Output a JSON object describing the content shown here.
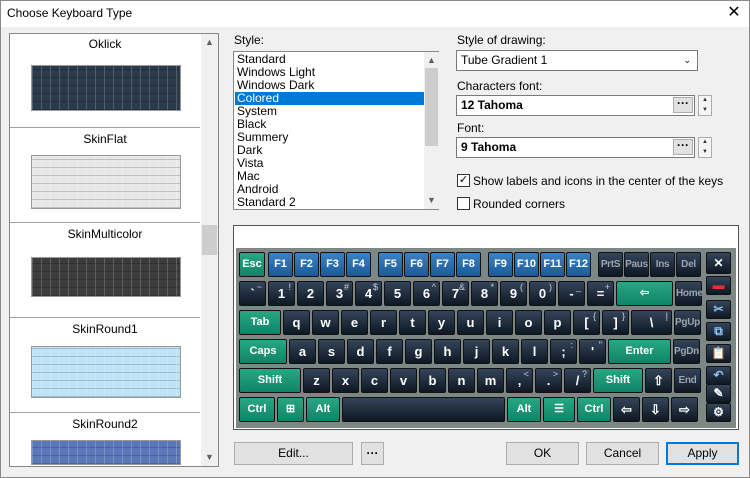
{
  "window": {
    "title": "Choose Keyboard Type",
    "close": "✕"
  },
  "skins": [
    {
      "name": "Oklick",
      "color": "#2a3a4c"
    },
    {
      "name": "SkinFlat",
      "color": "#e8e8e8"
    },
    {
      "name": "SkinMulticolor",
      "color": "#3c3c3c"
    },
    {
      "name": "SkinRound1",
      "color": "#bfe4f8"
    },
    {
      "name": "SkinRound2",
      "color": "#5a78b8"
    }
  ],
  "style": {
    "label": "Style:",
    "items": [
      "Standard",
      "Windows Light",
      "Windows Dark",
      "Colored",
      "System",
      "Black",
      "Summery",
      "Dark",
      "Vista",
      "Mac",
      "Android",
      "Standard 2"
    ],
    "selected": "Colored"
  },
  "drawing": {
    "label": "Style of drawing:",
    "value": "Tube Gradient 1"
  },
  "chars_font": {
    "label": "Characters font:",
    "value": "12 Tahoma",
    "browse": "···"
  },
  "font": {
    "label": "Font:",
    "value": "9 Tahoma",
    "browse": "···"
  },
  "options": {
    "show_labels": {
      "label": "Show labels and icons in the center of the keys",
      "checked": true
    },
    "rounded": {
      "label": "Rounded corners",
      "checked": false
    }
  },
  "keyboard": {
    "rows": [
      [
        {
          "l": "Esc",
          "c": "green"
        },
        {
          "l": "F1",
          "c": "blue"
        },
        {
          "l": "F2",
          "c": "blue"
        },
        {
          "l": "F3",
          "c": "blue"
        },
        {
          "l": "F4",
          "c": "blue"
        },
        {
          "l": "F5",
          "c": "blue"
        },
        {
          "l": "F6",
          "c": "blue"
        },
        {
          "l": "F7",
          "c": "blue"
        },
        {
          "l": "F8",
          "c": "blue"
        },
        {
          "l": "F9",
          "c": "blue"
        },
        {
          "l": "F10",
          "c": "blue"
        },
        {
          "l": "F11",
          "c": "blue"
        },
        {
          "l": "F12",
          "c": "blue"
        },
        {
          "l": "PrtS",
          "c": "gray"
        },
        {
          "l": "Paus",
          "c": "gray"
        },
        {
          "l": "Ins",
          "c": "gray"
        },
        {
          "l": "Del",
          "c": "gray"
        }
      ],
      [
        {
          "l": "`",
          "s": "~",
          "c": "dark"
        },
        {
          "l": "1",
          "s": "!",
          "c": "dark"
        },
        {
          "l": "2",
          "s": "",
          "c": "dark"
        },
        {
          "l": "3",
          "s": "#",
          "c": "dark"
        },
        {
          "l": "4",
          "s": "$",
          "c": "dark"
        },
        {
          "l": "5",
          "s": "",
          "c": "dark"
        },
        {
          "l": "6",
          "s": "^",
          "c": "dark"
        },
        {
          "l": "7",
          "s": "&",
          "c": "dark"
        },
        {
          "l": "8",
          "s": "*",
          "c": "dark"
        },
        {
          "l": "9",
          "s": "(",
          "c": "dark"
        },
        {
          "l": "0",
          "s": ")",
          "c": "dark"
        },
        {
          "l": "-",
          "s": "_",
          "c": "dark"
        },
        {
          "l": "=",
          "s": "+",
          "c": "dark"
        },
        {
          "l": "⇦",
          "c": "green"
        },
        {
          "l": "Home",
          "c": "gray"
        }
      ],
      [
        {
          "l": "Tab",
          "c": "green"
        },
        {
          "l": "q",
          "c": "dark"
        },
        {
          "l": "w",
          "c": "dark"
        },
        {
          "l": "e",
          "c": "dark"
        },
        {
          "l": "r",
          "c": "dark"
        },
        {
          "l": "t",
          "c": "dark"
        },
        {
          "l": "y",
          "c": "dark"
        },
        {
          "l": "u",
          "c": "dark"
        },
        {
          "l": "i",
          "c": "dark"
        },
        {
          "l": "o",
          "c": "dark"
        },
        {
          "l": "p",
          "c": "dark"
        },
        {
          "l": "[",
          "s": "{",
          "c": "dark"
        },
        {
          "l": "]",
          "s": "}",
          "c": "dark"
        },
        {
          "l": "\\",
          "s": "|",
          "c": "dark"
        },
        {
          "l": "PgUp",
          "c": "gray"
        }
      ],
      [
        {
          "l": "Caps",
          "c": "green"
        },
        {
          "l": "a",
          "c": "dark"
        },
        {
          "l": "s",
          "c": "dark"
        },
        {
          "l": "d",
          "c": "dark"
        },
        {
          "l": "f",
          "c": "dark"
        },
        {
          "l": "g",
          "c": "dark"
        },
        {
          "l": "h",
          "c": "dark"
        },
        {
          "l": "j",
          "c": "dark"
        },
        {
          "l": "k",
          "c": "dark"
        },
        {
          "l": "l",
          "c": "dark"
        },
        {
          "l": ";",
          "s": ":",
          "c": "dark"
        },
        {
          "l": "'",
          "s": "\"",
          "c": "dark"
        },
        {
          "l": "Enter",
          "c": "green"
        },
        {
          "l": "PgDn",
          "c": "gray"
        }
      ],
      [
        {
          "l": "Shift",
          "c": "green"
        },
        {
          "l": "z",
          "c": "dark"
        },
        {
          "l": "x",
          "c": "dark"
        },
        {
          "l": "c",
          "c": "dark"
        },
        {
          "l": "v",
          "c": "dark"
        },
        {
          "l": "b",
          "c": "dark"
        },
        {
          "l": "n",
          "c": "dark"
        },
        {
          "l": "m",
          "c": "dark"
        },
        {
          "l": ",",
          "s": "<",
          "c": "dark"
        },
        {
          "l": ".",
          "s": ">",
          "c": "dark"
        },
        {
          "l": "/",
          "s": "?",
          "c": "dark"
        },
        {
          "l": "Shift",
          "c": "green"
        },
        {
          "l": "⇧",
          "c": "dark"
        },
        {
          "l": "End",
          "c": "gray"
        }
      ],
      [
        {
          "l": "Ctrl",
          "c": "green"
        },
        {
          "l": "⊞",
          "c": "green"
        },
        {
          "l": "Alt",
          "c": "green"
        },
        {
          "l": "",
          "c": "dark"
        },
        {
          "l": "Alt",
          "c": "green"
        },
        {
          "l": "☰",
          "c": "green"
        },
        {
          "l": "Ctrl",
          "c": "green"
        },
        {
          "l": "⇦",
          "c": "dark"
        },
        {
          "l": "⇩",
          "c": "dark"
        },
        {
          "l": "⇨",
          "c": "dark"
        }
      ]
    ],
    "side": [
      {
        "l": "✕",
        "icon": "close-icon"
      },
      {
        "l": "▬",
        "icon": "flag-icon"
      },
      {
        "l": "✂",
        "icon": "cut-icon"
      },
      {
        "l": "⧉",
        "icon": "copy-icon"
      },
      {
        "l": "📋",
        "icon": "paste-icon"
      },
      {
        "l": "↶",
        "icon": "undo-icon"
      },
      {
        "l": "✎",
        "icon": "edit-icon"
      },
      {
        "l": "⚙",
        "icon": "gear-icon"
      }
    ]
  },
  "buttons": {
    "edit": "Edit...",
    "more": "···",
    "ok": "OK",
    "cancel": "Cancel",
    "apply": "Apply"
  }
}
